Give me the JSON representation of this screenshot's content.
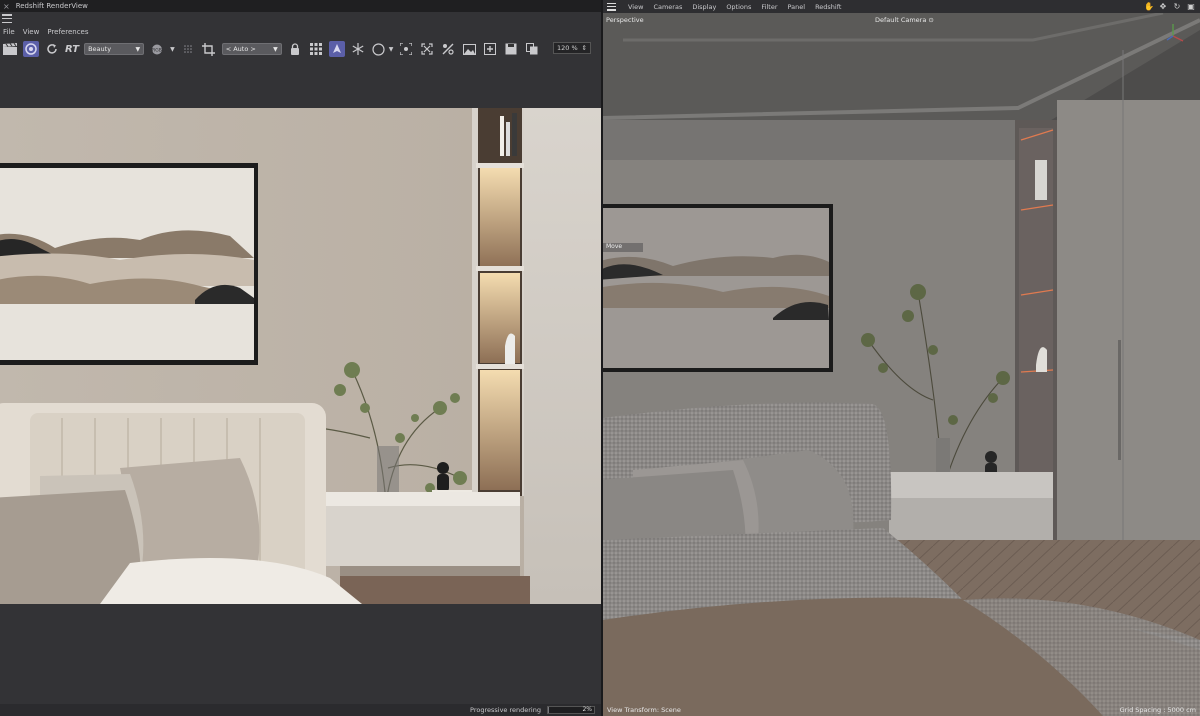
{
  "render_view": {
    "title": "Redshift RenderView",
    "close_glyph": "×",
    "menu": [
      "File",
      "View",
      "Preferences"
    ],
    "aov_select": "Beauty",
    "rt_label": "RT",
    "region_select": "< Auto >",
    "zoom": "120 %",
    "status": "Progressive rendering",
    "progress_label": "2%",
    "progress_fraction": 0.02
  },
  "viewport": {
    "menu": [
      "View",
      "Cameras",
      "Display",
      "Options",
      "Filter",
      "Panel",
      "Redshift"
    ],
    "view_name": "Perspective",
    "camera": "Default Camera",
    "camera_glyph": "⊙",
    "move_label": "Move",
    "view_transform": "View Transform: Scene",
    "grid_spacing": "Grid Spacing : 5000 cm"
  },
  "colors": {
    "accent": "#5b5fa8",
    "titlebar": "#1f1f21",
    "panel": "#333336"
  }
}
